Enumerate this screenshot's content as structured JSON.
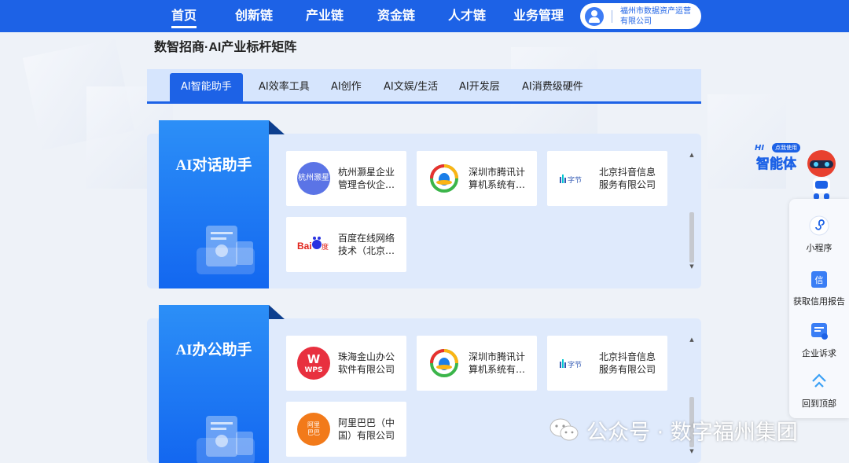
{
  "nav": {
    "items": [
      {
        "label": "首页",
        "active": true
      },
      {
        "label": "创新链",
        "active": false
      },
      {
        "label": "产业链",
        "active": false
      },
      {
        "label": "资金链",
        "active": false
      },
      {
        "label": "人才链",
        "active": false
      },
      {
        "label": "业务管理",
        "active": false
      }
    ],
    "user": {
      "name": "福州市数据资产运营有限公司"
    }
  },
  "page": {
    "title": "数智招商·AI产业标杆矩阵"
  },
  "tabs": [
    {
      "label": "AI智能助手",
      "active": true
    },
    {
      "label": "AI效率工具",
      "active": false
    },
    {
      "label": "AI创作",
      "active": false
    },
    {
      "label": "AI文娱/生活",
      "active": false
    },
    {
      "label": "AI开发层",
      "active": false
    },
    {
      "label": "AI消费级硬件",
      "active": false
    }
  ],
  "sections": [
    {
      "title": "AI对话助手",
      "cards": [
        {
          "name": "杭州灏星企业管理合伙企业（有限合伙）",
          "logo": "hz-logo",
          "logo_text": "杭州灏星"
        },
        {
          "name": "深圳市腾讯计算机系统有限公司",
          "logo": "tencent-logo"
        },
        {
          "name": "北京抖音信息服务有限公司",
          "logo": "bytedance-logo"
        },
        {
          "name": "百度在线网络技术（北京）有限公司",
          "logo": "baidu-logo"
        }
      ]
    },
    {
      "title": "AI办公助手",
      "cards": [
        {
          "name": "珠海金山办公软件有限公司",
          "logo": "wps-logo",
          "logo_text": "WPS"
        },
        {
          "name": "深圳市腾讯计算机系统有限公司",
          "logo": "tencent-logo"
        },
        {
          "name": "北京抖音信息服务有限公司",
          "logo": "bytedance-logo"
        },
        {
          "name": "阿里巴巴（中国）有限公司",
          "logo": "alibaba-logo"
        }
      ]
    }
  ],
  "floatbar": {
    "items": [
      {
        "label": "小程序",
        "icon": "mini-program-icon"
      },
      {
        "label": "获取信用报告",
        "icon": "credit-report-icon"
      },
      {
        "label": "企业诉求",
        "icon": "enterprise-request-icon"
      },
      {
        "label": "回到顶部",
        "icon": "back-to-top-icon"
      }
    ],
    "agent": {
      "hi": "HI",
      "tag": "点我使用",
      "title": "智能体"
    }
  },
  "watermark": {
    "text": "公众号 · 数字福州集团"
  },
  "colors": {
    "primary": "#1d62e6",
    "panel": "#dfeafc",
    "tab_bg": "#d6e5fd"
  }
}
